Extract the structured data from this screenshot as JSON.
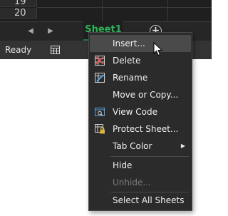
{
  "grid": {
    "rows": [
      "19",
      "20"
    ]
  },
  "sheet_tabs": {
    "prev_icon": "triangle-left",
    "next_icon": "triangle-right",
    "active_tab": "Sheet1",
    "add_icon": "plus-circle",
    "add_symbol": "+"
  },
  "status_bar": {
    "ready": "Ready",
    "mode_icon": "page-layout-icon"
  },
  "context_menu": {
    "items": [
      {
        "label": "Insert...",
        "icon": null,
        "highlighted": true,
        "enabled": true
      },
      {
        "label": "Delete",
        "icon": "delete-sheet-icon",
        "enabled": true
      },
      {
        "label": "Rename",
        "icon": "rename-sheet-icon",
        "enabled": true
      },
      {
        "label": "Move or Copy...",
        "icon": null,
        "enabled": true
      },
      {
        "label": "View Code",
        "icon": "view-code-icon",
        "enabled": true
      },
      {
        "label": "Protect Sheet...",
        "icon": "protect-sheet-icon",
        "enabled": true
      },
      {
        "label": "Tab Color",
        "icon": null,
        "enabled": true,
        "submenu_symbol": "▶"
      },
      {
        "label": "Hide",
        "icon": null,
        "enabled": true
      },
      {
        "label": "Unhide...",
        "icon": null,
        "enabled": false
      },
      {
        "label": "Select All Sheets",
        "icon": null,
        "enabled": true
      }
    ]
  },
  "colors": {
    "accent_green": "#2fb35a",
    "menu_bg": "#2b2b2b",
    "menu_highlight": "#4a4a4a",
    "disabled_text": "#7b7b7b"
  }
}
